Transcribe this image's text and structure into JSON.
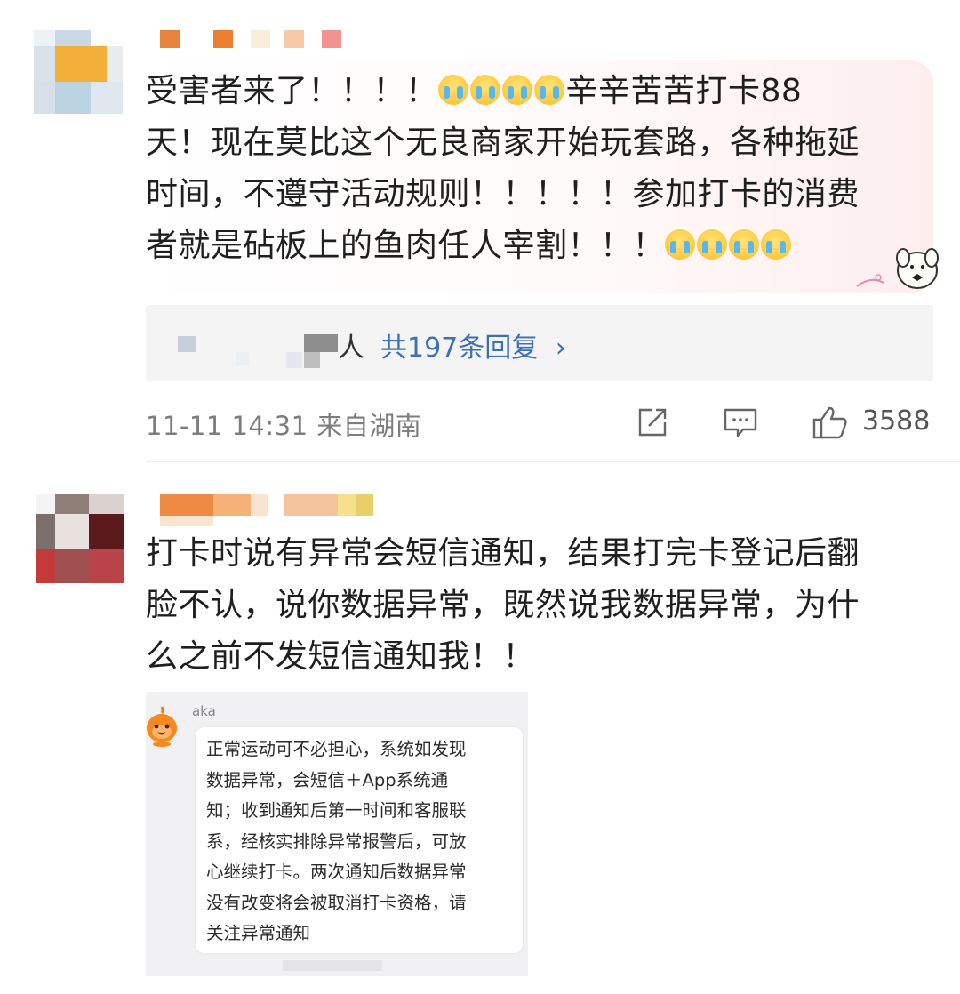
{
  "comment1": {
    "line1_text": "受害者来了！！！！",
    "line1_tail": "辛辛苦苦打卡88",
    "line2": "天！现在莫比这个无良商家开始玩套路，各种拖延",
    "line3": "时间，不遵守活动规则！！！！！参加打卡的消费",
    "line4_text": "者就是砧板上的鱼肉任人宰割！！！",
    "emoji_name": "crying-face-icon",
    "replies_prefix": "人",
    "replies_label": "共197条回复",
    "replies_arrow": "›",
    "timestamp": "11-11 14:31",
    "location": "来自湖南",
    "like_count": "3588"
  },
  "comment2": {
    "line1": "打卡时说有异常会短信通知，结果打完卡登记后翻",
    "line2": "脸不认，说你数据异常，既然说我数据异常，为什",
    "line3": "么之前不发短信通知我！！"
  },
  "screenshot": {
    "sender": "aka",
    "message": "正常运动可不必担心，系统如发现\n数据异常，会短信＋App系统通\n知；收到通知后第一时间和客服联\n系，经核实排除异常报警后，可放\n心继续打卡。两次通知后数据异常\n没有改变将会被取消打卡资格，请\n关注异常通知"
  },
  "colors": {
    "link_blue": "#3b6fb6",
    "meta_gray": "#7d7d7d",
    "reply_box": "#f4f4f4"
  }
}
